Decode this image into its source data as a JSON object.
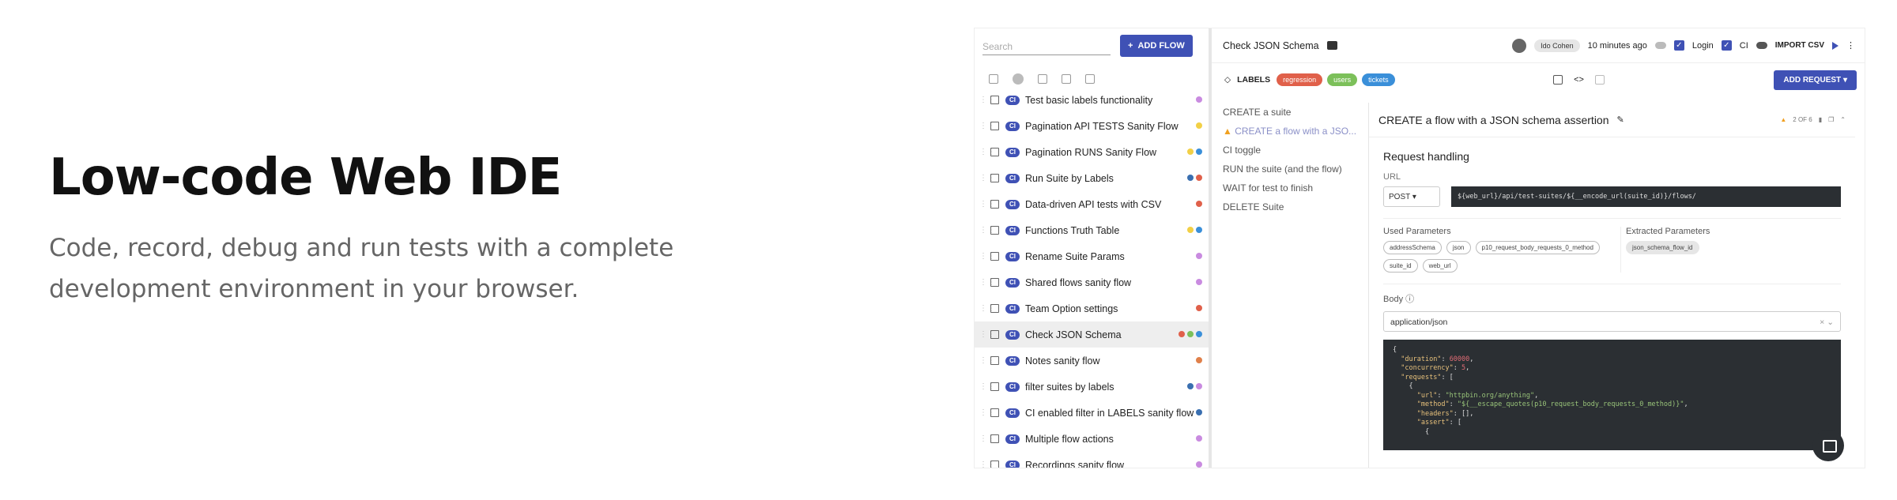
{
  "hero": {
    "title": "Low-code Web IDE",
    "subtitle": "Code, record, debug and run tests with a complete development environment in your browser."
  },
  "flows": {
    "search_placeholder": "Search",
    "add_label": "ADD FLOW",
    "items": [
      {
        "label": "Test basic labels functionality",
        "dots": [
          "#c98be0"
        ]
      },
      {
        "label": "Pagination API TESTS Sanity Flow",
        "dots": [
          "#f2d046"
        ]
      },
      {
        "label": "Pagination RUNS Sanity Flow",
        "dots": [
          "#f2d046",
          "#3a8fd9"
        ]
      },
      {
        "label": "Run Suite by Labels",
        "dots": [
          "#3a6fb0",
          "#e0604a"
        ]
      },
      {
        "label": "Data-driven API tests with CSV",
        "dots": [
          "#e0604a"
        ]
      },
      {
        "label": "Functions Truth Table",
        "dots": [
          "#f2d046",
          "#3a8fd9"
        ]
      },
      {
        "label": "Rename Suite Params",
        "dots": [
          "#c98be0"
        ]
      },
      {
        "label": "Shared flows sanity flow",
        "dots": [
          "#c98be0"
        ]
      },
      {
        "label": "Team Option settings",
        "dots": [
          "#e0604a"
        ]
      },
      {
        "label": "Check JSON Schema",
        "dots": [
          "#e0604a",
          "#7cc05a",
          "#3a8fd9"
        ],
        "selected": true
      },
      {
        "label": "Notes sanity flow",
        "dots": [
          "#e0804a"
        ]
      },
      {
        "label": "filter suites by labels",
        "dots": [
          "#3a6fb0",
          "#c98be0"
        ]
      },
      {
        "label": "CI enabled filter in LABELS sanity flow",
        "dots": [
          "#3a6fb0"
        ]
      },
      {
        "label": "Multiple flow actions",
        "dots": [
          "#c98be0"
        ]
      },
      {
        "label": "Recordings sanity flow",
        "dots": [
          "#c98be0"
        ]
      }
    ],
    "ci_badge": "CI"
  },
  "header": {
    "title": "Check JSON Schema",
    "user": "Ido Cohen",
    "time": "10 minutes ago",
    "login": "Login",
    "ci": "CI",
    "import": "IMPORT CSV"
  },
  "labels": {
    "label": "LABELS",
    "items": [
      {
        "text": "regression",
        "color": "#e0604a"
      },
      {
        "text": "users",
        "color": "#7cc05a"
      },
      {
        "text": "tickets",
        "color": "#3a8fd9"
      }
    ],
    "add_request": "ADD REQUEST"
  },
  "steps": [
    {
      "text": "CREATE a suite"
    },
    {
      "text": "CREATE a flow with a JSO...",
      "active": true
    },
    {
      "text": "CI toggle"
    },
    {
      "text": "RUN the suite (and the flow)"
    },
    {
      "text": "WAIT for test to finish"
    },
    {
      "text": "DELETE Suite"
    }
  ],
  "editor": {
    "title": "CREATE a flow with a JSON schema assertion",
    "counter": "2 OF 6",
    "section": "Request handling",
    "url_label": "URL",
    "method": "POST",
    "url": "${web_url}/api/test-suites/${__encode_url(suite_id)}/flows/",
    "used_params_label": "Used Parameters",
    "used_params": [
      "addressSchema",
      "json",
      "p10_request_body_requests_0_method",
      "suite_id",
      "web_url"
    ],
    "extracted_label": "Extracted Parameters",
    "extracted": [
      "json_schema_flow_id"
    ],
    "body_label": "Body",
    "content_type": "application/json"
  }
}
